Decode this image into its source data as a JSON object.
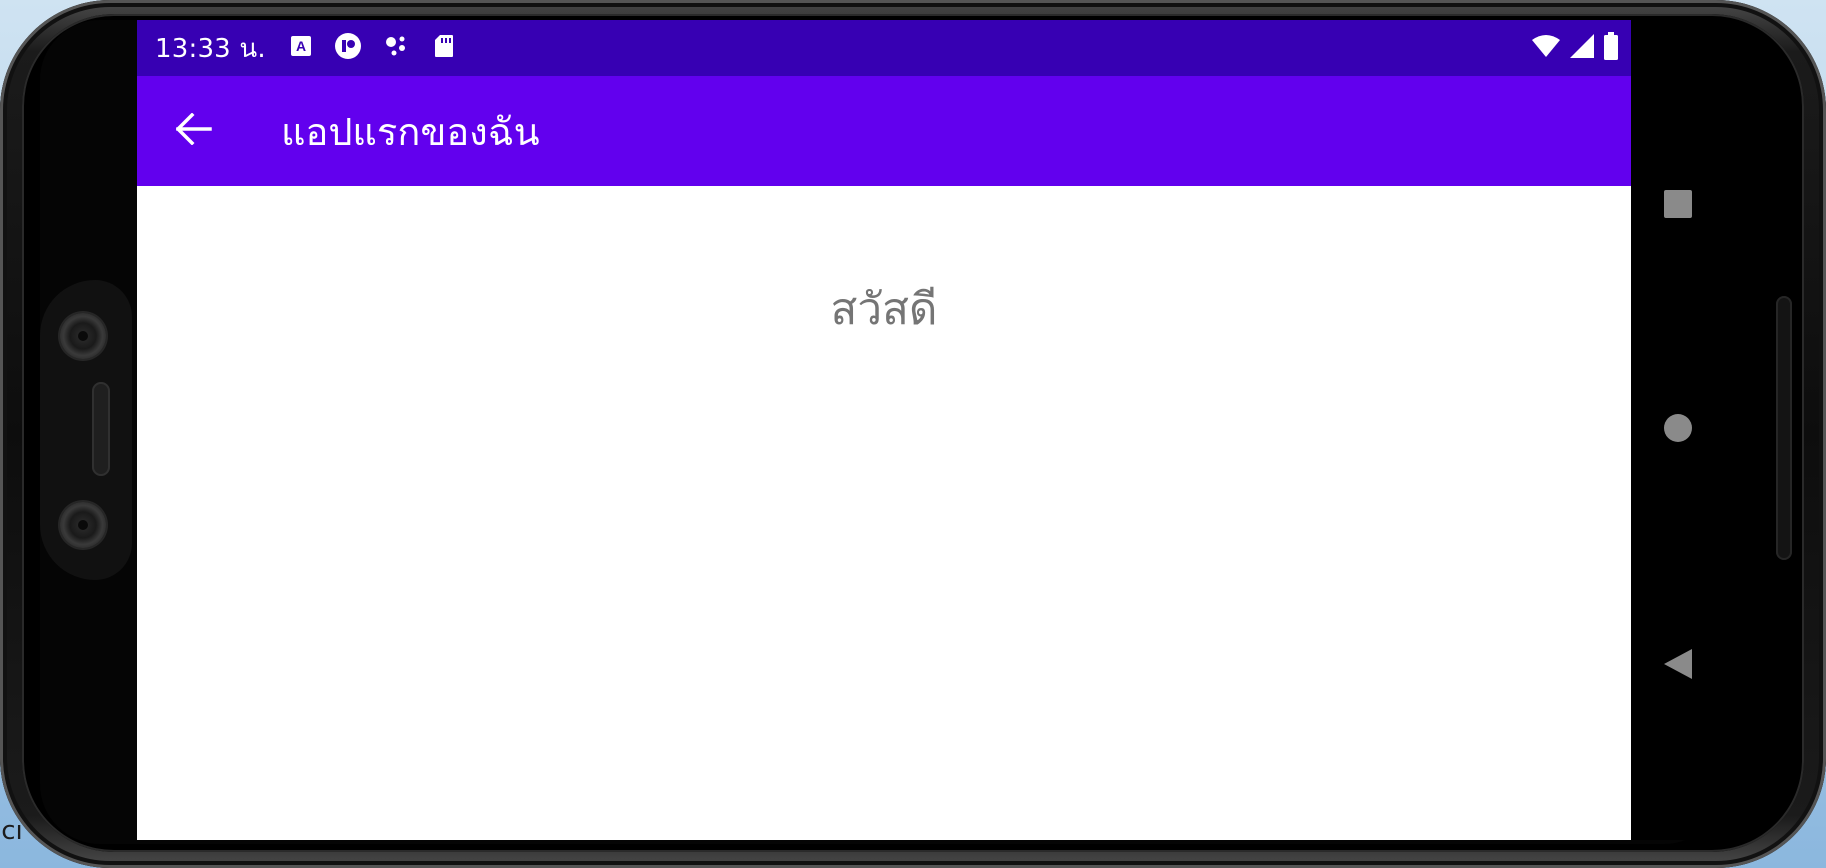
{
  "background_text": "ıcı",
  "status_bar": {
    "time": "13:33 น.",
    "left_icons": [
      "text-a-icon",
      "assistant-icon",
      "dots-icon",
      "sd-card-icon"
    ],
    "right_icons": [
      "wifi-icon",
      "cell-signal-icon",
      "battery-icon"
    ],
    "color": "#3700b3"
  },
  "app_bar": {
    "title": "แอปแรกของฉัน",
    "back_icon": "arrow-back-icon",
    "color": "#6200ee"
  },
  "content": {
    "greeting": "สวัสดี"
  },
  "navigation": {
    "buttons": [
      "recents-button",
      "home-button",
      "back-button"
    ]
  }
}
